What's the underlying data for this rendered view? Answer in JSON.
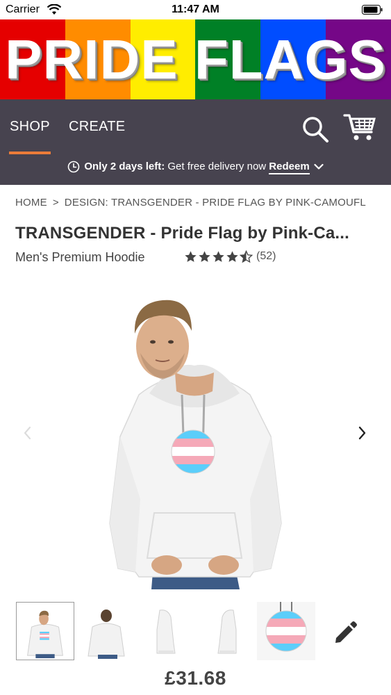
{
  "status_bar": {
    "carrier": "Carrier",
    "time": "11:47 AM"
  },
  "banner": {
    "title": "PRIDE FLAGS",
    "stripe_colors": [
      "#e50000",
      "#ff8c00",
      "#ffed00",
      "#008026",
      "#004dff",
      "#750787"
    ]
  },
  "nav": {
    "tabs": [
      {
        "label": "SHOP",
        "active": true
      },
      {
        "label": "CREATE",
        "active": false
      }
    ],
    "active_color": "#ec7c39",
    "background": "#47434f",
    "search_icon": "search-icon",
    "cart_icon": "cart-icon"
  },
  "promo": {
    "highlight": "Only 2 days left:",
    "text": " Get free delivery now ",
    "link": "Redeem"
  },
  "breadcrumb": {
    "items": [
      "HOME",
      "DESIGN: TRANSGENDER - PRIDE FLAG BY PINK-CAMOUFL"
    ],
    "separator": ">"
  },
  "product": {
    "title": "TRANSGENDER - Pride Flag by Pink-Ca...",
    "type": "Men's Premium Hoodie",
    "rating": 4.5,
    "rating_count": "(52)",
    "price": "£31.68"
  },
  "gallery": {
    "thumbnails": [
      "front-view",
      "back-view",
      "left-side-view",
      "right-side-view",
      "design-close-up"
    ],
    "active_index": 0
  },
  "flag_colors": {
    "blue": "#5bcefa",
    "pink": "#f5a9b8",
    "white": "#ffffff"
  }
}
